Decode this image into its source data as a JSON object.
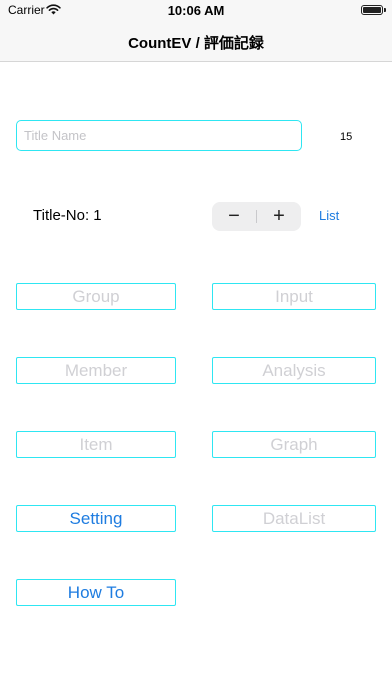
{
  "status_bar": {
    "carrier": "Carrier",
    "time": "10:06 AM"
  },
  "nav": {
    "title": "CountEV /  評価記録"
  },
  "title_field": {
    "placeholder": "Title Name",
    "value": "",
    "count": "15"
  },
  "title_no": {
    "label": "Title-No: 1"
  },
  "stepper": {
    "minus": "−",
    "plus": "+"
  },
  "list_link": "List",
  "buttons": {
    "group": "Group",
    "input": "Input",
    "member": "Member",
    "analysis": "Analysis",
    "item": "Item",
    "graph": "Graph",
    "setting": "Setting",
    "datalist": "DataList",
    "howto": "How To"
  },
  "colors": {
    "accent": "#1e7ce0",
    "border": "#2ee6f2",
    "disabled_text": "#d0d0d4"
  }
}
